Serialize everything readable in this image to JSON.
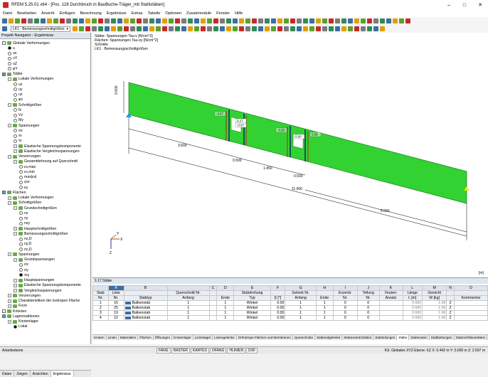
{
  "title": "RFEM 5.25.01 x64 - [Pos. 128 Durchbruch in BauBuche-Träger_mit Stahlstäben]",
  "window_controls": [
    "–",
    "□",
    "✕"
  ],
  "menu": [
    "Datei",
    "Bearbeiten",
    "Ansicht",
    "Einfügen",
    "Berechnung",
    "Ergebnisse",
    "Extras",
    "Tabelle",
    "Optionen",
    "Zusatzmodule",
    "Fenster",
    "Hilfe"
  ],
  "toolbar": {
    "loadcase_combo": "LK1 - Bemessungsschnittgrößen"
  },
  "nav": {
    "header": "Projekt-Navigator - Ergebnisse",
    "tree": [
      {
        "label": "Globale Verformungen",
        "lvl": 0,
        "kind": "chk"
      },
      {
        "label": "u",
        "lvl": 1,
        "kind": "radio",
        "on": true
      },
      {
        "label": "ux",
        "lvl": 1,
        "kind": "radio"
      },
      {
        "label": "uY",
        "lvl": 1,
        "kind": "radio"
      },
      {
        "label": "uZ",
        "lvl": 1,
        "kind": "radio"
      },
      {
        "label": "φY",
        "lvl": 1,
        "kind": "radio"
      },
      {
        "label": "Stäbe",
        "lvl": 0,
        "kind": "chk",
        "on": true
      },
      {
        "label": "Lokale Verformungen",
        "lvl": 1,
        "kind": "exp"
      },
      {
        "label": "ux",
        "lvl": 2,
        "kind": "radio"
      },
      {
        "label": "uy",
        "lvl": 2,
        "kind": "radio"
      },
      {
        "label": "uz",
        "lvl": 2,
        "kind": "radio"
      },
      {
        "label": "φx",
        "lvl": 2,
        "kind": "radio"
      },
      {
        "label": "Schnittgrößen",
        "lvl": 1,
        "kind": "exp"
      },
      {
        "label": "N",
        "lvl": 2,
        "kind": "radio"
      },
      {
        "label": "Vz",
        "lvl": 2,
        "kind": "radio"
      },
      {
        "label": "My",
        "lvl": 2,
        "kind": "radio"
      },
      {
        "label": "Spannungen",
        "lvl": 1,
        "kind": "exp"
      },
      {
        "label": "σx",
        "lvl": 2,
        "kind": "radio"
      },
      {
        "label": "τx",
        "lvl": 2,
        "kind": "radio"
      },
      {
        "label": "τv",
        "lvl": 2,
        "kind": "radio"
      },
      {
        "label": "Elastische Spannungskomponente",
        "lvl": 2,
        "kind": "exp"
      },
      {
        "label": "Elastische Vergleichsspannungen",
        "lvl": 2,
        "kind": "exp"
      },
      {
        "label": "Verzerrungen",
        "lvl": 1,
        "kind": "exp"
      },
      {
        "label": "Gesamtdehnung auf Querschnitt",
        "lvl": 2,
        "kind": "exp"
      },
      {
        "label": "εx,max",
        "lvl": 3,
        "kind": "radio"
      },
      {
        "label": "εx,min",
        "lvl": 3,
        "kind": "radio"
      },
      {
        "label": "max|εx|",
        "lvl": 3,
        "kind": "radio"
      },
      {
        "label": "γxz",
        "lvl": 3,
        "kind": "radio"
      },
      {
        "label": "κy",
        "lvl": 3,
        "kind": "radio"
      },
      {
        "label": "Flächen",
        "lvl": 0,
        "kind": "chk",
        "on": true
      },
      {
        "label": "Lokale Verformungen",
        "lvl": 1,
        "kind": "exp"
      },
      {
        "label": "Schnittgrößen",
        "lvl": 1,
        "kind": "exp"
      },
      {
        "label": "Grundschnittgrößen",
        "lvl": 2,
        "kind": "exp"
      },
      {
        "label": "nx",
        "lvl": 3,
        "kind": "radio"
      },
      {
        "label": "ny",
        "lvl": 3,
        "kind": "radio"
      },
      {
        "label": "nxy",
        "lvl": 3,
        "kind": "radio"
      },
      {
        "label": "Hauptschnittgrößen",
        "lvl": 2,
        "kind": "exp"
      },
      {
        "label": "Bemessungsschnittgrößen",
        "lvl": 2,
        "kind": "exp"
      },
      {
        "label": "nx,D",
        "lvl": 3,
        "kind": "radio"
      },
      {
        "label": "ny,D",
        "lvl": 3,
        "kind": "radio"
      },
      {
        "label": "nc,D",
        "lvl": 3,
        "kind": "radio"
      },
      {
        "label": "Spannungen",
        "lvl": 1,
        "kind": "exp"
      },
      {
        "label": "Grundspannungen",
        "lvl": 2,
        "kind": "exp"
      },
      {
        "label": "σx",
        "lvl": 3,
        "kind": "radio"
      },
      {
        "label": "σy",
        "lvl": 3,
        "kind": "radio"
      },
      {
        "label": "τxy",
        "lvl": 3,
        "kind": "radio",
        "on": true
      },
      {
        "label": "Hauptspannungen",
        "lvl": 2,
        "kind": "exp"
      },
      {
        "label": "Elastische Spannungskomponente",
        "lvl": 2,
        "kind": "exp"
      },
      {
        "label": "Vergleichsspannungen",
        "lvl": 2,
        "kind": "exp"
      },
      {
        "label": "Verzerrungen",
        "lvl": 1,
        "kind": "exp"
      },
      {
        "label": "Charakteristiken der isotropen Fläche",
        "lvl": 1,
        "kind": "exp"
      },
      {
        "label": "Form",
        "lvl": 1,
        "kind": "exp"
      },
      {
        "label": "Kriterien",
        "lvl": 0,
        "kind": "chk"
      },
      {
        "label": "Lagerreaktionen",
        "lvl": 0,
        "kind": "chk",
        "on": true
      },
      {
        "label": "Knotenlager",
        "lvl": 1,
        "kind": "exp"
      },
      {
        "label": "Lokal",
        "lvl": 2,
        "kind": "radio",
        "on": true
      }
    ],
    "tabs": [
      "Daten",
      "Zeigen",
      "Ansichten",
      "Ergebnisse"
    ]
  },
  "view": {
    "info": [
      "Stäbe: Spannungen Tau-v [N/cm^2]",
      "Flächen: Spannungen Tau-xy [N/cm^2]",
      "Schnitte",
      "LK1 : Bemessungsschnittgrößen"
    ],
    "dims": {
      "height": "0.600",
      "d1": "3.600",
      "d2": "0.500",
      "d3": "1.450",
      "d4": "0.500",
      "total": "11.600",
      "d5": "5.550"
    },
    "result_labels": [
      "-0.67",
      "0.27",
      "-0.67",
      "-0.60",
      "0.60",
      "0.59"
    ],
    "unit": "[m]",
    "axes": {
      "x": "X",
      "y": "Y",
      "z": "Z"
    }
  },
  "table": {
    "header": "1.17 Stäbe",
    "col_letters": [
      "",
      "A",
      "B",
      "",
      "C",
      "D",
      "E",
      "F",
      "G",
      "H",
      "I",
      "J",
      "K",
      "L",
      "M",
      "N",
      "O"
    ],
    "head1": [
      "Stab",
      "Linie",
      "",
      "Querschnitt Nr.",
      "",
      "",
      "Stabdrehung",
      "",
      "Gelenk Nr.",
      "",
      "Exzentr.",
      "Teilung",
      "Vouten-",
      "Länge",
      "Gewicht",
      "",
      ""
    ],
    "head2": [
      "Nr.",
      "Nr.",
      "Stabtyp",
      "Anfang",
      "",
      "Ende",
      "Typ",
      "β [°]",
      "Anfang",
      "Ende",
      "Nr.",
      "Nr.",
      "Ansatz",
      "L [m]",
      "W [kg]",
      "",
      "Kommentar"
    ],
    "rows": [
      {
        "nr": "1",
        "linie": "16",
        "typ": "Balkenstab",
        "qa": "1",
        "qe": "1",
        "dtyp": "Winkel",
        "beta": "0.00",
        "ga": "1",
        "ge": "1",
        "ex": "0",
        "tl": "0",
        "va": "",
        "len": "0.680",
        "w": "1.68",
        "ax": "Z"
      },
      {
        "nr": "2",
        "linie": "25",
        "typ": "Balkenstab",
        "qa": "1",
        "qe": "1",
        "dtyp": "Winkel",
        "beta": "0.00",
        "ga": "1",
        "ge": "1",
        "ex": "0",
        "tl": "0",
        "va": "",
        "len": "0.680",
        "w": "1.68",
        "ax": "Z"
      },
      {
        "nr": "3",
        "linie": "19",
        "typ": "Balkenstab",
        "qa": "1",
        "qe": "1",
        "dtyp": "Winkel",
        "beta": "0.00",
        "ga": "1",
        "ge": "1",
        "ex": "0",
        "tl": "0",
        "va": "",
        "len": "0.680",
        "w": "1.68",
        "ax": "Z"
      },
      {
        "nr": "4",
        "linie": "22",
        "typ": "Balkenstab",
        "qa": "1",
        "qe": "1",
        "dtyp": "Winkel",
        "beta": "0.00",
        "ga": "1",
        "ge": "1",
        "ex": "0",
        "tl": "0",
        "va": "",
        "len": "0.680",
        "w": "1.68",
        "ax": "Z"
      }
    ],
    "bottom_tabs": [
      "Knoten",
      "Linien",
      "Materialien",
      "Flächen",
      "Öffnungen",
      "Knotenlager",
      "Linienlager",
      "Liniengelenke",
      "Orthotrope Flächen und Membranen",
      "Querschnitte",
      "Stabendgelenke",
      "Stabexzentrizitäten",
      "Stabteilungen",
      "Stäbe",
      "Stabvouten",
      "Stabbettungen",
      "Stabnichtlinearitäten"
    ],
    "active_tab": "Stäbe"
  },
  "status": {
    "left": "Arbeitsebene",
    "toggles": [
      "FANG",
      "RASTER",
      "KARTES",
      "OFANG",
      "HLINIEN",
      "DXF"
    ],
    "coords": "KS: Globales XYZ  Ebene: XZ     X: 0.442 m   Y: 0.000 m   Z: 2.597 m"
  }
}
